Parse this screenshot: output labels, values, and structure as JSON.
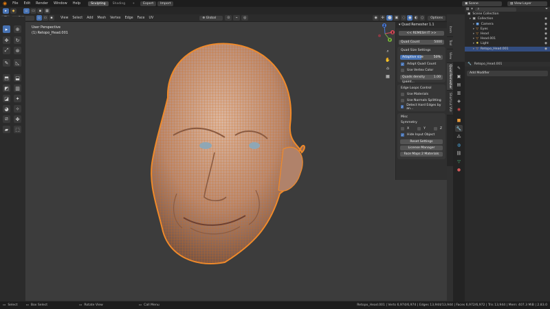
{
  "topbar": {
    "menus": [
      "File",
      "Edit",
      "Render",
      "Window",
      "Help"
    ],
    "workspaces": [
      "Sculpting",
      "Shading"
    ],
    "plus": "+",
    "export_label": "Export",
    "import_label": "Import",
    "scene_label": "Scene",
    "view_layer_label": "View Layer"
  },
  "header": {
    "mode": "Edit Mode",
    "menus": [
      "View",
      "Select",
      "Add",
      "Mesh",
      "Vertex",
      "Edge",
      "Face",
      "UV"
    ],
    "orientation": "Global",
    "options": "Options"
  },
  "viewport": {
    "perspective": "User Perspective",
    "object_label": "(1) Retopo_Head.001",
    "mesh_color": "#e8872e",
    "skin_color": "#c9a089"
  },
  "npanel": {
    "title": "Quad Remesher 1.1",
    "remesh_button": "<< REMESH IT >>",
    "quad_count_label": "Quad Count",
    "quad_count_value": "5000",
    "quad_size_title": "Quad Size Settings",
    "adaptive_size_label": "Adaptive size",
    "adaptive_size_value": "50%",
    "adaptive_size_fraction": 0.5,
    "adapt_quad_count": "Adapt Quad Count",
    "use_vertex_color": "Use Vertex Color",
    "quads_density_label": "Quads density (paint...",
    "quads_density_value": "1.00",
    "edge_loops_title": "Edge Loops Control",
    "use_materials": "Use Materials",
    "use_normals_splitting": "Use Normals Splitting",
    "detect_hard_edges": "Detect Hard Edges by an...",
    "misc_title": "Misc",
    "symmetry_label": "Symmetry",
    "sym_x": "X",
    "sym_y": "Y",
    "sym_z": "Z",
    "hide_input_object": "Hide Input Object",
    "reset_settings": "Reset Settings",
    "license_manager": "License Manager",
    "face_maps_button": "Face Maps 2 Materials",
    "check_adapt": true,
    "check_vertex_color": false,
    "check_materials": false,
    "check_normals": false,
    "check_hard_edges": true,
    "check_x": false,
    "check_y": false,
    "check_z": false,
    "check_hide_input": true
  },
  "side_tabs": [
    "Item",
    "Tool",
    "View",
    "Quad Remesher",
    "Shortcut VUr"
  ],
  "outliner": {
    "root": "Scene Collection",
    "items": [
      {
        "label": "Collection",
        "indent": 1
      },
      {
        "label": "Camera",
        "indent": 2
      },
      {
        "label": "Eyes",
        "indent": 2
      },
      {
        "label": "Head",
        "indent": 2
      },
      {
        "label": "Head.001",
        "indent": 2
      },
      {
        "label": "Light",
        "indent": 2
      },
      {
        "label": "Retopo_Head.001",
        "indent": 2
      }
    ]
  },
  "properties": {
    "object_name": "Retopo_Head.001",
    "add_modifier": "Add Modifier"
  },
  "statusbar": {
    "select": "Select",
    "box_select": "Box Select",
    "rotate_view": "Rotate View",
    "call_menu": "Call Menu",
    "stats": "Retopo_Head.001 | Verts 6,974/6,974 | Edges 13,944/13,944 | Faces 6,972/6,972 | Tris 13,944 | Mem: 407.3 MiB | 2.83.0"
  },
  "gizmo": {
    "x": "X",
    "y": "Y",
    "z": "Z"
  }
}
